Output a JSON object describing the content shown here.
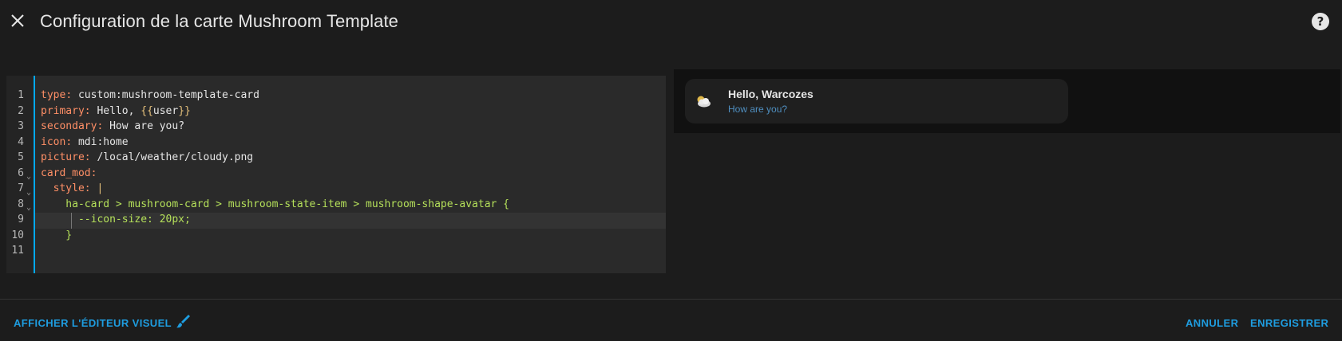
{
  "header": {
    "title": "Configuration de la carte Mushroom Template",
    "close_icon": "close-icon",
    "help_icon": "help-circle-icon"
  },
  "editor": {
    "line_numbers": [
      "1",
      "2",
      "3",
      "4",
      "5",
      "6",
      "7",
      "8",
      "9",
      "10",
      "11"
    ],
    "lines": [
      {
        "key": "type",
        "sep": ": ",
        "value": "custom:mushroom-template-card"
      },
      {
        "key": "primary",
        "sep": ": ",
        "value": "Hello, ",
        "brace_open": "{{",
        "brace_inner": "user",
        "brace_close": "}}"
      },
      {
        "key": "secondary",
        "sep": ": ",
        "value": "How are you?"
      },
      {
        "key": "icon",
        "sep": ": ",
        "value": "mdi:home"
      },
      {
        "key": "picture",
        "sep": ": ",
        "value": "/local/weather/cloudy.png"
      },
      {
        "key": "card_mod",
        "sep": ":"
      },
      {
        "key": "  style",
        "sep": ": ",
        "value": "|"
      },
      {
        "css": "    ha-card > mushroom-card > mushroom-state-item > mushroom-shape-avatar {"
      },
      {
        "css": "      --icon-size: 20px;"
      },
      {
        "css": "    }"
      }
    ],
    "accent_color": "#03a9f4"
  },
  "preview": {
    "card_primary": "Hello, Warcozes",
    "card_secondary": "How are you?",
    "card_icon": "cloudy-weather-icon"
  },
  "footer": {
    "visual_editor_label": "AFFICHER L'ÉDITEUR VISUEL",
    "visual_editor_icon": "brush-icon",
    "cancel_label": "ANNULER",
    "save_label": "ENREGISTRER",
    "accent_color": "#1e9de0"
  }
}
